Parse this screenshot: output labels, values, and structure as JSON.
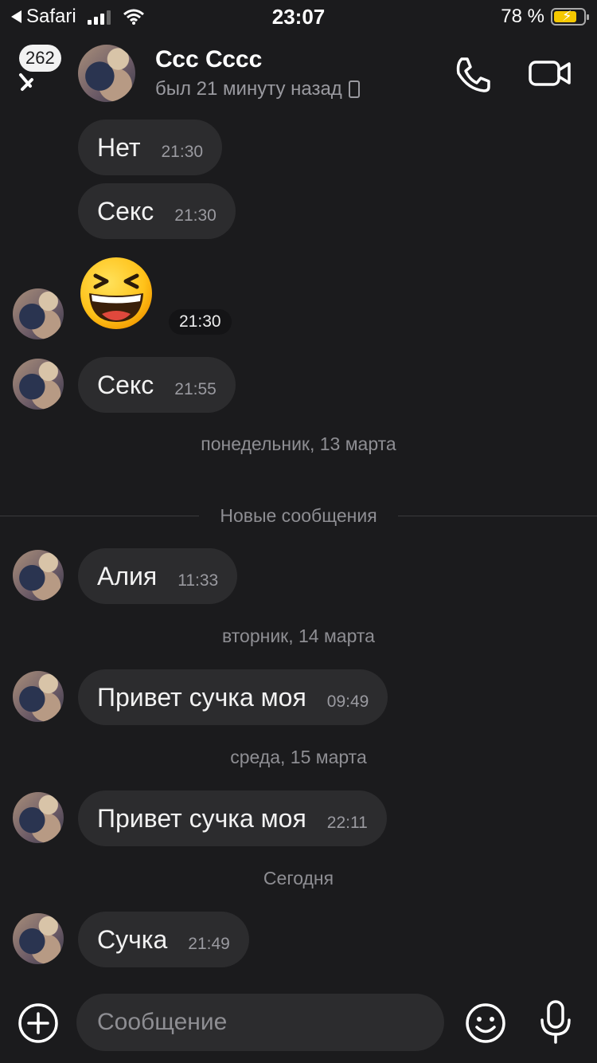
{
  "status_bar": {
    "carrier": "Safari",
    "time": "23:07",
    "battery": "78 %",
    "battery_level": 0.78
  },
  "header": {
    "back_badge": "262",
    "contact_name": "Ссс Сссс",
    "contact_status": "был 21 минуту назад",
    "icons": [
      "back-icon",
      "phone-icon",
      "video-camera-icon"
    ]
  },
  "messages": [
    {
      "text": "Нет",
      "time": "21:30"
    },
    {
      "text": "Секс",
      "time": "21:30"
    },
    {
      "emoji": "😆",
      "time": "21:30"
    },
    {
      "text": "Секс",
      "time": "21:55"
    },
    {
      "text": "Алия",
      "time": "11:33"
    },
    {
      "text": "Привет сучка моя",
      "time": "09:49"
    },
    {
      "text": "Привет сучка моя",
      "time": "22:11"
    },
    {
      "text": "Сучка",
      "time": "21:49"
    }
  ],
  "separators": {
    "mon": "понедельник, 13 марта",
    "new_messages": "Новые сообщения",
    "tue": "вторник, 14 марта",
    "wed": "среда, 15 марта",
    "today": "Сегодня"
  },
  "composer": {
    "placeholder": "Сообщение"
  }
}
